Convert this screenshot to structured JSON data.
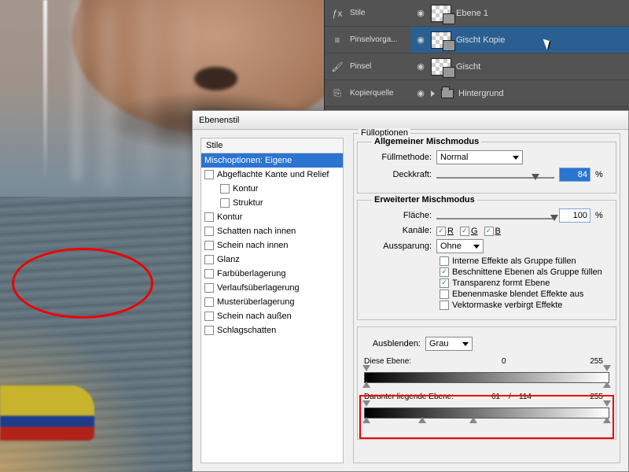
{
  "toolcol": [
    {
      "icon": "fx",
      "label": "Stile"
    },
    {
      "icon": "brushprefs",
      "label": "Pinselvorga..."
    },
    {
      "icon": "brush",
      "label": "Pinsel"
    },
    {
      "icon": "clone",
      "label": "Kopierquelle"
    }
  ],
  "layers": [
    {
      "name": "Ebene 1",
      "selected": false,
      "type": "layer"
    },
    {
      "name": "Gischt Kopie",
      "selected": true,
      "type": "layer"
    },
    {
      "name": "Gischt",
      "selected": false,
      "type": "layer"
    },
    {
      "name": "Hintergrund",
      "selected": false,
      "type": "group"
    }
  ],
  "dialog": {
    "title": "Ebenenstil",
    "stylesHeader": "Stile",
    "styleItems": [
      {
        "label": "Mischoptionen: Eigene",
        "selected": true,
        "checkbox": false
      },
      {
        "label": "Abgeflachte Kante und Relief",
        "checkbox": true
      },
      {
        "label": "Kontur",
        "checkbox": true,
        "indent": true
      },
      {
        "label": "Struktur",
        "checkbox": true,
        "indent": true
      },
      {
        "label": "Kontur",
        "checkbox": true
      },
      {
        "label": "Schatten nach innen",
        "checkbox": true
      },
      {
        "label": "Schein nach innen",
        "checkbox": true
      },
      {
        "label": "Glanz",
        "checkbox": true
      },
      {
        "label": "Farbüberlagerung",
        "checkbox": true
      },
      {
        "label": "Verlaufsüberlagerung",
        "checkbox": true
      },
      {
        "label": "Musterüberlagerung",
        "checkbox": true
      },
      {
        "label": "Schein nach außen",
        "checkbox": true
      },
      {
        "label": "Schlagschatten",
        "checkbox": true
      }
    ],
    "fillOptionsTitle": "Fülloptionen",
    "generalGroup": "Allgemeiner Mischmodus",
    "fillMethodLabel": "Füllmethode:",
    "fillMethodValue": "Normal",
    "opacityLabel": "Deckkraft:",
    "opacityValue": "84",
    "opacityKnob": 84,
    "advancedGroup": "Erweiterter Mischmodus",
    "fillLabel": "Fläche:",
    "fillValue": "100",
    "channelsLabel": "Kanäle:",
    "channels": [
      "R",
      "G",
      "B"
    ],
    "knockoutLabel": "Aussparung:",
    "knockoutValue": "Ohne",
    "advChecks": [
      {
        "label": "Interne Effekte als Gruppe füllen",
        "on": false
      },
      {
        "label": "Beschnittene Ebenen als Gruppe füllen",
        "on": true
      },
      {
        "label": "Transparenz formt Ebene",
        "on": true
      },
      {
        "label": "Ebenenmaske blendet Effekte aus",
        "on": false
      },
      {
        "label": "Vektormaske verbirgt Effekte",
        "on": false
      }
    ],
    "blendIf": {
      "label": "Ausblenden:",
      "value": "Grau",
      "thisLayerLabel": "Diese Ebene:",
      "thisLayerLow": "0",
      "thisLayerHigh": "255",
      "underLabel": "Darunter liegende Ebene:",
      "underLowA": "61",
      "underSep": "/",
      "underLowB": "114",
      "underHigh": "255"
    },
    "percent": "%"
  }
}
